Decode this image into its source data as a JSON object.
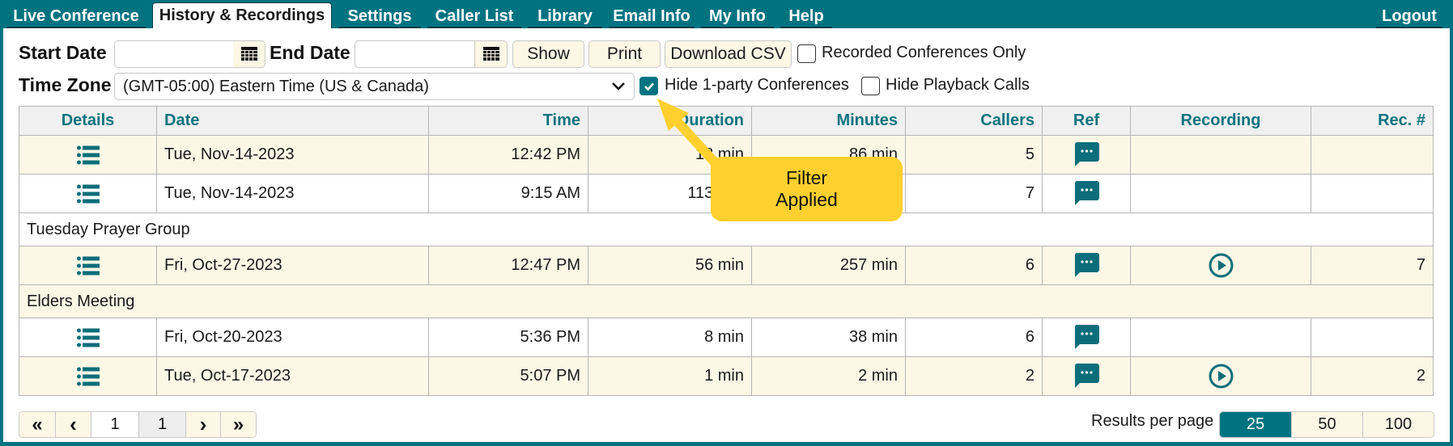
{
  "nav": {
    "tabs": [
      {
        "label": "Live Conference",
        "active": false
      },
      {
        "label": "History & Recordings",
        "active": true
      },
      {
        "label": "Settings",
        "active": false
      },
      {
        "label": "Caller List",
        "active": false
      },
      {
        "label": "Library",
        "active": false
      },
      {
        "label": "Email Info",
        "active": false
      },
      {
        "label": "My Info",
        "active": false
      },
      {
        "label": "Help",
        "active": false
      }
    ],
    "logout": "Logout"
  },
  "filters": {
    "start_date_label": "Start Date",
    "start_date_value": "",
    "end_date_label": "End Date",
    "end_date_value": "",
    "show_label": "Show",
    "print_label": "Print",
    "download_label": "Download CSV",
    "recorded_only_label": "Recorded Conferences Only",
    "recorded_only_checked": false,
    "timezone_label": "Time Zone",
    "timezone_value": "(GMT-05:00) Eastern Time (US & Canada)",
    "hide_one_party_label": "Hide 1-party Conferences",
    "hide_one_party_checked": true,
    "hide_playback_label": "Hide Playback Calls",
    "hide_playback_checked": false
  },
  "table": {
    "columns": [
      "Details",
      "Date",
      "Time",
      "Duration",
      "Minutes",
      "Callers",
      "Ref",
      "Recording",
      "Rec. #"
    ],
    "rows": [
      {
        "type": "data",
        "date": "Tue, Nov-14-2023",
        "time": "12:42 PM",
        "duration": "18 min",
        "minutes": "86 min",
        "callers": "5",
        "ref": true,
        "recording": false,
        "rec_no": ""
      },
      {
        "type": "data",
        "date": "Tue, Nov-14-2023",
        "time": "9:15 AM",
        "duration": "113 min",
        "minutes": "",
        "callers": "7",
        "ref": true,
        "recording": false,
        "rec_no": ""
      },
      {
        "type": "group",
        "label": "Tuesday Prayer Group"
      },
      {
        "type": "data",
        "date": "Fri, Oct-27-2023",
        "time": "12:47 PM",
        "duration": "56 min",
        "minutes": "257 min",
        "callers": "6",
        "ref": true,
        "recording": true,
        "rec_no": "7"
      },
      {
        "type": "group",
        "label": "Elders Meeting"
      },
      {
        "type": "data",
        "date": "Fri, Oct-20-2023",
        "time": "5:36 PM",
        "duration": "8 min",
        "minutes": "38 min",
        "callers": "6",
        "ref": true,
        "recording": false,
        "rec_no": ""
      },
      {
        "type": "data",
        "date": "Tue, Oct-17-2023",
        "time": "5:07 PM",
        "duration": "1 min",
        "minutes": "2 min",
        "callers": "2",
        "ref": true,
        "recording": true,
        "rec_no": "2"
      }
    ]
  },
  "pagination": {
    "first": "«",
    "prev": "‹",
    "current_page": "1",
    "total_pages": "1",
    "next": "›",
    "last": "»",
    "results_per_page_label": "Results per page",
    "options": [
      "25",
      "50",
      "100"
    ],
    "selected": "25"
  },
  "callout": {
    "line1": "Filter",
    "line2": "Applied"
  },
  "colors": {
    "brand": "#007380",
    "row_alt": "#fdf7e6",
    "callout": "#ffd02e"
  },
  "icons": {
    "details": "list-icon",
    "ref": "comment-icon",
    "recording": "play-circle-icon",
    "calendar": "calendar-icon"
  }
}
